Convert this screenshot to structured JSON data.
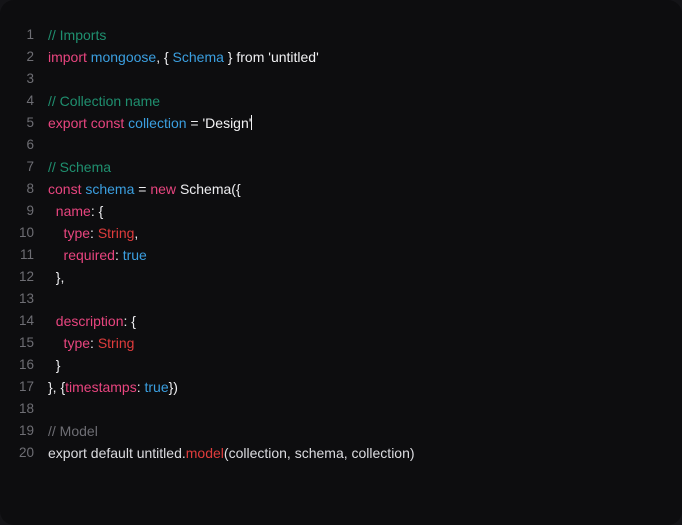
{
  "editor": {
    "name": "code-editor",
    "background_color": "#0d0d0f",
    "outer_background_color": "#141417",
    "gutter_color": "#6e6e74",
    "default_text_color": "#e6e6e8",
    "cursor_line": 5,
    "total_lines": 20,
    "language": "javascript",
    "colors": {
      "comment_teal": "#1f8f6f",
      "comment_gray": "#6e6e74",
      "keyword_pink": "#e8457f",
      "variable_blue": "#3b9fe0",
      "type_red": "#e03c3c",
      "boolean_blue": "#3b9fe0",
      "plain_white": "#ededf0",
      "string_white": "#f2f2f4"
    }
  },
  "lines": [
    {
      "number": "1",
      "tokens": [
        {
          "c": "t-comment",
          "t": "// Imports"
        }
      ]
    },
    {
      "number": "2",
      "tokens": [
        {
          "c": "t-keyword",
          "t": "import"
        },
        {
          "c": "t-plain",
          "t": " "
        },
        {
          "c": "t-var",
          "t": "mongoose"
        },
        {
          "c": "t-punct",
          "t": ", { "
        },
        {
          "c": "t-var",
          "t": "Schema"
        },
        {
          "c": "t-punct",
          "t": " } "
        },
        {
          "c": "t-plain",
          "t": "from "
        },
        {
          "c": "t-string",
          "t": "'untitled'"
        }
      ]
    },
    {
      "number": "3",
      "tokens": []
    },
    {
      "number": "4",
      "tokens": [
        {
          "c": "t-comment",
          "t": "// Collection name"
        }
      ]
    },
    {
      "number": "5",
      "tokens": [
        {
          "c": "t-keyword",
          "t": "export const"
        },
        {
          "c": "t-plain",
          "t": " "
        },
        {
          "c": "t-var",
          "t": "collection"
        },
        {
          "c": "t-punct",
          "t": " = "
        },
        {
          "c": "t-string",
          "t": "'Design'"
        }
      ],
      "caret": true
    },
    {
      "number": "6",
      "tokens": []
    },
    {
      "number": "7",
      "tokens": [
        {
          "c": "t-comment",
          "t": "// Schema"
        }
      ]
    },
    {
      "number": "8",
      "tokens": [
        {
          "c": "t-keyword",
          "t": "const"
        },
        {
          "c": "t-plain",
          "t": " "
        },
        {
          "c": "t-var",
          "t": "schema"
        },
        {
          "c": "t-punct",
          "t": " = "
        },
        {
          "c": "t-keyword",
          "t": "new"
        },
        {
          "c": "t-plain",
          "t": " "
        },
        {
          "c": "t-punct",
          "t": "Schema({"
        }
      ]
    },
    {
      "number": "9",
      "tokens": [
        {
          "c": "t-prop",
          "t": "  name"
        },
        {
          "c": "t-punct",
          "t": ": {"
        }
      ]
    },
    {
      "number": "10",
      "tokens": [
        {
          "c": "t-prop",
          "t": "    type"
        },
        {
          "c": "t-punct",
          "t": ": "
        },
        {
          "c": "t-type",
          "t": "String"
        },
        {
          "c": "t-punct",
          "t": ","
        }
      ]
    },
    {
      "number": "11",
      "tokens": [
        {
          "c": "t-prop",
          "t": "    required"
        },
        {
          "c": "t-punct",
          "t": ": "
        },
        {
          "c": "t-bool",
          "t": "true"
        }
      ]
    },
    {
      "number": "12",
      "tokens": [
        {
          "c": "t-punct",
          "t": "  },"
        }
      ]
    },
    {
      "number": "13",
      "tokens": []
    },
    {
      "number": "14",
      "tokens": [
        {
          "c": "t-prop",
          "t": "  description"
        },
        {
          "c": "t-punct",
          "t": ": {"
        }
      ]
    },
    {
      "number": "15",
      "tokens": [
        {
          "c": "t-prop",
          "t": "    type"
        },
        {
          "c": "t-punct",
          "t": ": "
        },
        {
          "c": "t-type",
          "t": "String"
        }
      ]
    },
    {
      "number": "16",
      "tokens": [
        {
          "c": "t-punct",
          "t": "  }"
        }
      ]
    },
    {
      "number": "17",
      "tokens": [
        {
          "c": "t-punct",
          "t": "}, {"
        },
        {
          "c": "t-prop",
          "t": "timestamps"
        },
        {
          "c": "t-punct",
          "t": ": "
        },
        {
          "c": "t-bool",
          "t": "true"
        },
        {
          "c": "t-punct",
          "t": "})"
        }
      ]
    },
    {
      "number": "18",
      "tokens": []
    },
    {
      "number": "19",
      "tokens": [
        {
          "c": "t-comment-g",
          "t": "// Model"
        }
      ]
    },
    {
      "number": "20",
      "tokens": [
        {
          "c": "t-ident",
          "t": "export default untitled."
        },
        {
          "c": "t-method",
          "t": "model"
        },
        {
          "c": "t-ident",
          "t": "(collection, schema, collection)"
        }
      ]
    }
  ]
}
